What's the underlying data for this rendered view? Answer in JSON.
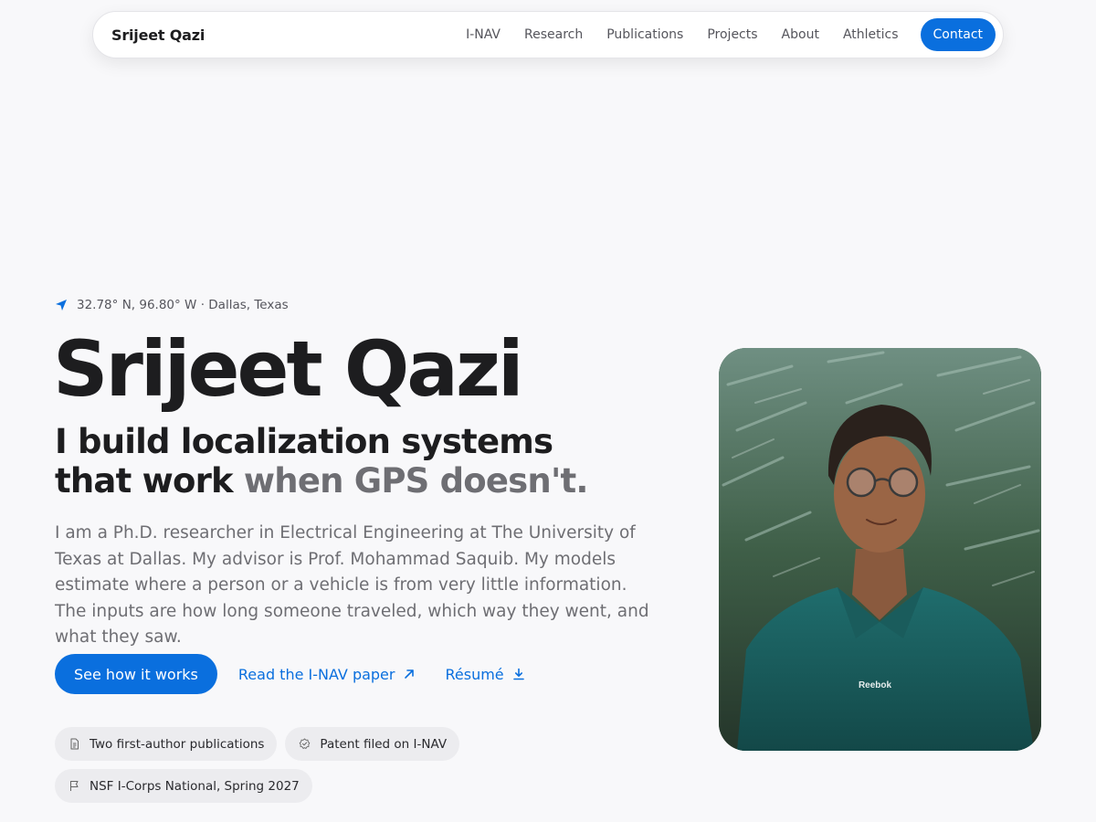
{
  "nav": {
    "brand": "Srijeet Qazi",
    "links": [
      "I-NAV",
      "Research",
      "Publications",
      "Projects",
      "About",
      "Athletics"
    ],
    "contact": "Contact"
  },
  "hero": {
    "coordinates": "32.78° N, 96.80° W · Dallas, Texas",
    "name": "Srijeet Qazi",
    "tagline_main": "I build localization systems that work",
    "tagline_muted": "when GPS doesn't.",
    "bio": "I am a Ph.D. researcher in Electrical Engineering at The University of Texas at Dallas. My advisor is Prof. Mohammad Saquib. My models estimate where a person or a vehicle is from very little information. The inputs are how long someone traveled, which way they went, and what they saw.",
    "cta_primary": "See how it works",
    "cta_paper": "Read the I-NAV paper",
    "cta_resume": "Résumé",
    "chips": [
      {
        "icon": "document-icon",
        "label": "Two first-author publications"
      },
      {
        "icon": "badge-check-icon",
        "label": "Patent filed on I-NAV"
      },
      {
        "icon": "flag-icon",
        "label": "NSF I-Corps National, Spring 2027"
      }
    ]
  },
  "portrait": {
    "shirt_logo": "Reebok"
  },
  "colors": {
    "accent": "#0a6fde",
    "background": "#f8f8fa",
    "text": "#1d1d1f",
    "muted": "#6e6e73",
    "chip_bg": "#ececef"
  }
}
